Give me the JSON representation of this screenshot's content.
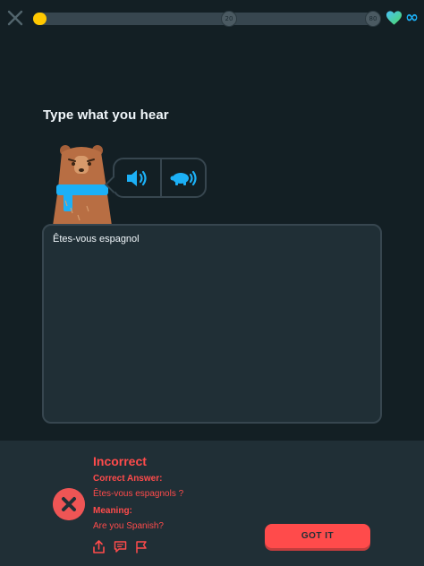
{
  "progress": {
    "fraction": 0.04,
    "milestones": [
      "20",
      "80"
    ]
  },
  "hearts": {
    "count": "∞"
  },
  "challenge": {
    "prompt": "Type what you hear",
    "typed_answer": "Êtes-vous espagnol"
  },
  "feedback": {
    "status": "Incorrect",
    "correct_answer_label": "Correct Answer:",
    "correct_answer": "Êtes-vous espagnols ?",
    "meaning_label": "Meaning:",
    "meaning": "Are you Spanish?",
    "button_label": "GOT IT"
  },
  "colors": {
    "background": "#131f24",
    "panel": "#202f36",
    "error": "#ff4b4b",
    "progress": "#ffc800",
    "accent": "#1cb0f6"
  },
  "icons": [
    "close-icon",
    "heart-icon",
    "infinity-icon",
    "speaker-icon",
    "turtle-slow-icon",
    "x-circle-icon",
    "share-icon",
    "comment-icon",
    "flag-icon"
  ]
}
